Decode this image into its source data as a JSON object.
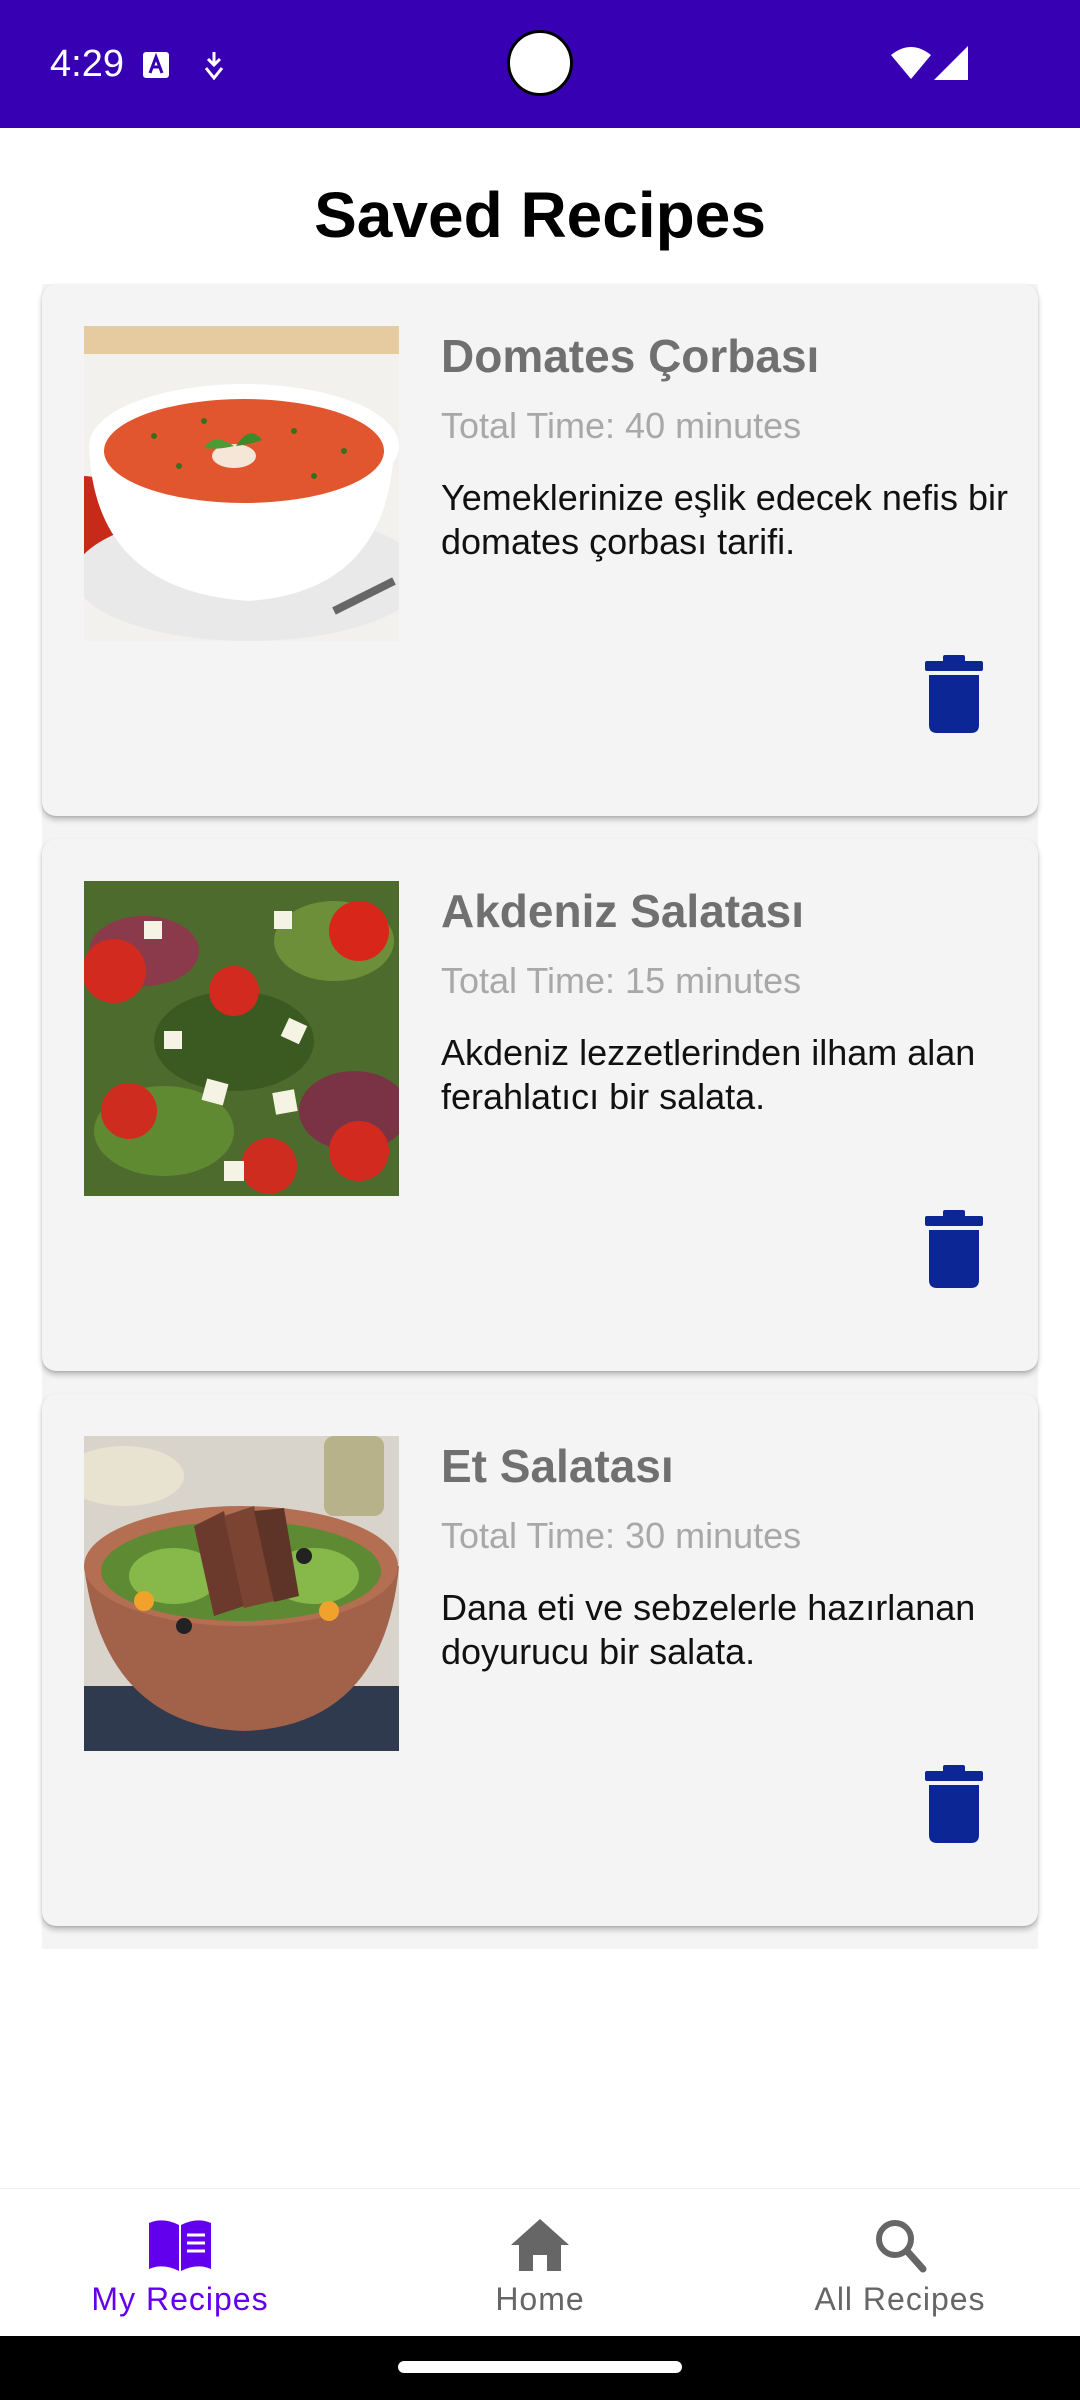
{
  "status_bar": {
    "time": "4:29",
    "icons": [
      "font-icon",
      "download-icon",
      "wifi-icon",
      "signal-icon"
    ],
    "background": "#3700b3"
  },
  "page": {
    "title": "Saved Recipes"
  },
  "recipes": [
    {
      "title": "Domates Çorbası",
      "time": "Total Time: 40 minutes",
      "description": "Yemeklerinize eşlik edecek nefis bir domates çorbası tarifi.",
      "image": "tomato-soup-image",
      "delete_icon": "trash-icon"
    },
    {
      "title": "Akdeniz Salatası",
      "time": "Total Time: 15 minutes",
      "description": "Akdeniz lezzetlerinden ilham alan ferahlatıcı bir salata.",
      "image": "mediterranean-salad-image",
      "delete_icon": "trash-icon"
    },
    {
      "title": "Et Salatası",
      "time": "Total Time: 30 minutes",
      "description": "Dana eti ve sebzelerle hazırlanan doyurucu bir salata.",
      "image": "beef-salad-image",
      "delete_icon": "trash-icon"
    }
  ],
  "bottom_nav": {
    "items": [
      {
        "label": "My Recipes",
        "icon": "book-icon",
        "active": true
      },
      {
        "label": "Home",
        "icon": "home-icon",
        "active": false
      },
      {
        "label": "All Recipes",
        "icon": "search-icon",
        "active": false
      }
    ],
    "active_color": "#6200ee",
    "inactive_color": "#666666"
  },
  "colors": {
    "delete_icon": "#0d2696",
    "card_background": "#f4f4f4",
    "title_text": "#707070",
    "time_text": "#a8a8a8"
  }
}
